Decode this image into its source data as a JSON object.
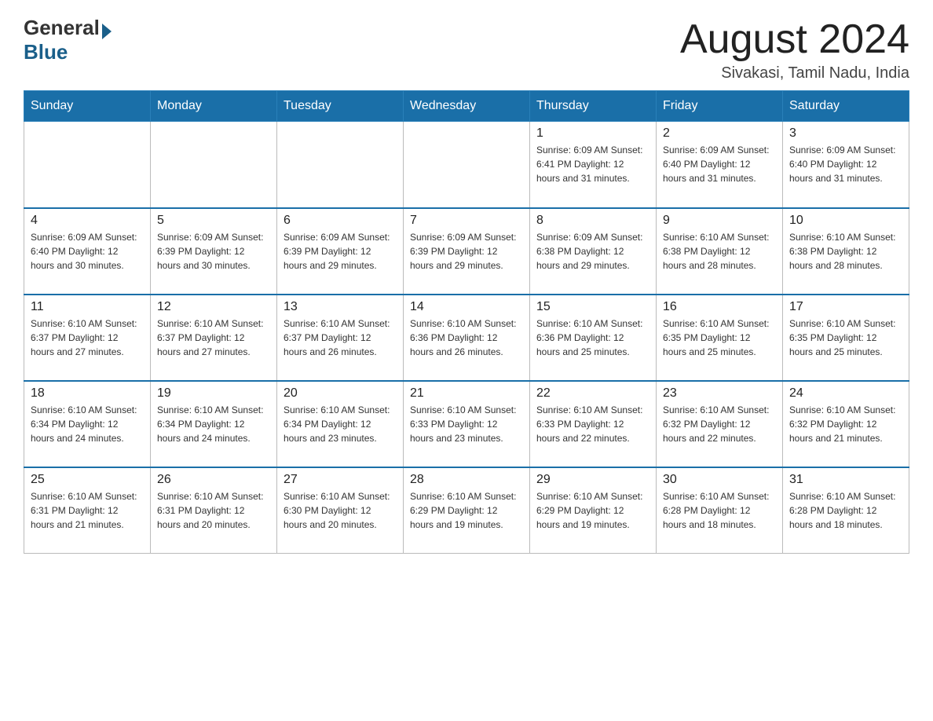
{
  "header": {
    "logo_general": "General",
    "logo_blue": "Blue",
    "month_year": "August 2024",
    "location": "Sivakasi, Tamil Nadu, India"
  },
  "days_of_week": [
    "Sunday",
    "Monday",
    "Tuesday",
    "Wednesday",
    "Thursday",
    "Friday",
    "Saturday"
  ],
  "weeks": [
    [
      {
        "day": "",
        "info": ""
      },
      {
        "day": "",
        "info": ""
      },
      {
        "day": "",
        "info": ""
      },
      {
        "day": "",
        "info": ""
      },
      {
        "day": "1",
        "info": "Sunrise: 6:09 AM\nSunset: 6:41 PM\nDaylight: 12 hours\nand 31 minutes."
      },
      {
        "day": "2",
        "info": "Sunrise: 6:09 AM\nSunset: 6:40 PM\nDaylight: 12 hours\nand 31 minutes."
      },
      {
        "day": "3",
        "info": "Sunrise: 6:09 AM\nSunset: 6:40 PM\nDaylight: 12 hours\nand 31 minutes."
      }
    ],
    [
      {
        "day": "4",
        "info": "Sunrise: 6:09 AM\nSunset: 6:40 PM\nDaylight: 12 hours\nand 30 minutes."
      },
      {
        "day": "5",
        "info": "Sunrise: 6:09 AM\nSunset: 6:39 PM\nDaylight: 12 hours\nand 30 minutes."
      },
      {
        "day": "6",
        "info": "Sunrise: 6:09 AM\nSunset: 6:39 PM\nDaylight: 12 hours\nand 29 minutes."
      },
      {
        "day": "7",
        "info": "Sunrise: 6:09 AM\nSunset: 6:39 PM\nDaylight: 12 hours\nand 29 minutes."
      },
      {
        "day": "8",
        "info": "Sunrise: 6:09 AM\nSunset: 6:38 PM\nDaylight: 12 hours\nand 29 minutes."
      },
      {
        "day": "9",
        "info": "Sunrise: 6:10 AM\nSunset: 6:38 PM\nDaylight: 12 hours\nand 28 minutes."
      },
      {
        "day": "10",
        "info": "Sunrise: 6:10 AM\nSunset: 6:38 PM\nDaylight: 12 hours\nand 28 minutes."
      }
    ],
    [
      {
        "day": "11",
        "info": "Sunrise: 6:10 AM\nSunset: 6:37 PM\nDaylight: 12 hours\nand 27 minutes."
      },
      {
        "day": "12",
        "info": "Sunrise: 6:10 AM\nSunset: 6:37 PM\nDaylight: 12 hours\nand 27 minutes."
      },
      {
        "day": "13",
        "info": "Sunrise: 6:10 AM\nSunset: 6:37 PM\nDaylight: 12 hours\nand 26 minutes."
      },
      {
        "day": "14",
        "info": "Sunrise: 6:10 AM\nSunset: 6:36 PM\nDaylight: 12 hours\nand 26 minutes."
      },
      {
        "day": "15",
        "info": "Sunrise: 6:10 AM\nSunset: 6:36 PM\nDaylight: 12 hours\nand 25 minutes."
      },
      {
        "day": "16",
        "info": "Sunrise: 6:10 AM\nSunset: 6:35 PM\nDaylight: 12 hours\nand 25 minutes."
      },
      {
        "day": "17",
        "info": "Sunrise: 6:10 AM\nSunset: 6:35 PM\nDaylight: 12 hours\nand 25 minutes."
      }
    ],
    [
      {
        "day": "18",
        "info": "Sunrise: 6:10 AM\nSunset: 6:34 PM\nDaylight: 12 hours\nand 24 minutes."
      },
      {
        "day": "19",
        "info": "Sunrise: 6:10 AM\nSunset: 6:34 PM\nDaylight: 12 hours\nand 24 minutes."
      },
      {
        "day": "20",
        "info": "Sunrise: 6:10 AM\nSunset: 6:34 PM\nDaylight: 12 hours\nand 23 minutes."
      },
      {
        "day": "21",
        "info": "Sunrise: 6:10 AM\nSunset: 6:33 PM\nDaylight: 12 hours\nand 23 minutes."
      },
      {
        "day": "22",
        "info": "Sunrise: 6:10 AM\nSunset: 6:33 PM\nDaylight: 12 hours\nand 22 minutes."
      },
      {
        "day": "23",
        "info": "Sunrise: 6:10 AM\nSunset: 6:32 PM\nDaylight: 12 hours\nand 22 minutes."
      },
      {
        "day": "24",
        "info": "Sunrise: 6:10 AM\nSunset: 6:32 PM\nDaylight: 12 hours\nand 21 minutes."
      }
    ],
    [
      {
        "day": "25",
        "info": "Sunrise: 6:10 AM\nSunset: 6:31 PM\nDaylight: 12 hours\nand 21 minutes."
      },
      {
        "day": "26",
        "info": "Sunrise: 6:10 AM\nSunset: 6:31 PM\nDaylight: 12 hours\nand 20 minutes."
      },
      {
        "day": "27",
        "info": "Sunrise: 6:10 AM\nSunset: 6:30 PM\nDaylight: 12 hours\nand 20 minutes."
      },
      {
        "day": "28",
        "info": "Sunrise: 6:10 AM\nSunset: 6:29 PM\nDaylight: 12 hours\nand 19 minutes."
      },
      {
        "day": "29",
        "info": "Sunrise: 6:10 AM\nSunset: 6:29 PM\nDaylight: 12 hours\nand 19 minutes."
      },
      {
        "day": "30",
        "info": "Sunrise: 6:10 AM\nSunset: 6:28 PM\nDaylight: 12 hours\nand 18 minutes."
      },
      {
        "day": "31",
        "info": "Sunrise: 6:10 AM\nSunset: 6:28 PM\nDaylight: 12 hours\nand 18 minutes."
      }
    ]
  ]
}
